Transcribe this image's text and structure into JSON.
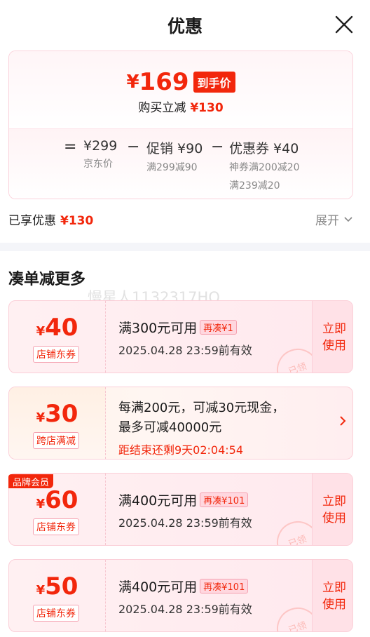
{
  "header": {
    "title": "优惠"
  },
  "summary": {
    "currency": "¥",
    "final_price": "169",
    "final_tag": "到手价",
    "buy_reduce_label": "购买立减",
    "buy_reduce_value": "¥130",
    "calc": {
      "eq": "=",
      "minus": "−",
      "jd_price": "¥299",
      "jd_label": "京东价",
      "promo": "促销 ¥90",
      "promo_sub": "满299减90",
      "coupon": "优惠券 ¥40",
      "coupon_sub1": "神券满200减20",
      "coupon_sub2": "满239减20"
    },
    "enjoyed_label": "已享优惠",
    "enjoyed_value": "¥130",
    "expand_label": "展开"
  },
  "section_title": "凑单减更多",
  "watermark": "慢星人1132317HQ",
  "coupons": [
    {
      "amount": "40",
      "type": "店铺东券",
      "condition": "满300元可用",
      "extra": "再凑¥1",
      "validity": "2025.04.28 23:59前有效",
      "action": "立即使用",
      "stamp": "已领"
    },
    {
      "amount": "30",
      "type": "跨店满减",
      "line1": "每满200元，可减30元现金，",
      "line2": "最多可减40000元",
      "countdown": "距结束还剩9天02:04:54"
    },
    {
      "badge": "品牌会员",
      "amount": "60",
      "type": "店铺东券",
      "condition": "满400元可用",
      "extra": "再凑¥101",
      "validity": "2025.04.28 23:59前有效",
      "action": "立即使用",
      "stamp": "已领"
    },
    {
      "amount": "50",
      "type": "店铺东券",
      "condition": "满400元可用",
      "extra": "再凑¥101",
      "validity": "2025.04.28 23:59前有效",
      "action": "立即使用",
      "stamp": "已领"
    }
  ],
  "colors": {
    "accent": "#f2270c",
    "border": "#fbcfd8"
  }
}
